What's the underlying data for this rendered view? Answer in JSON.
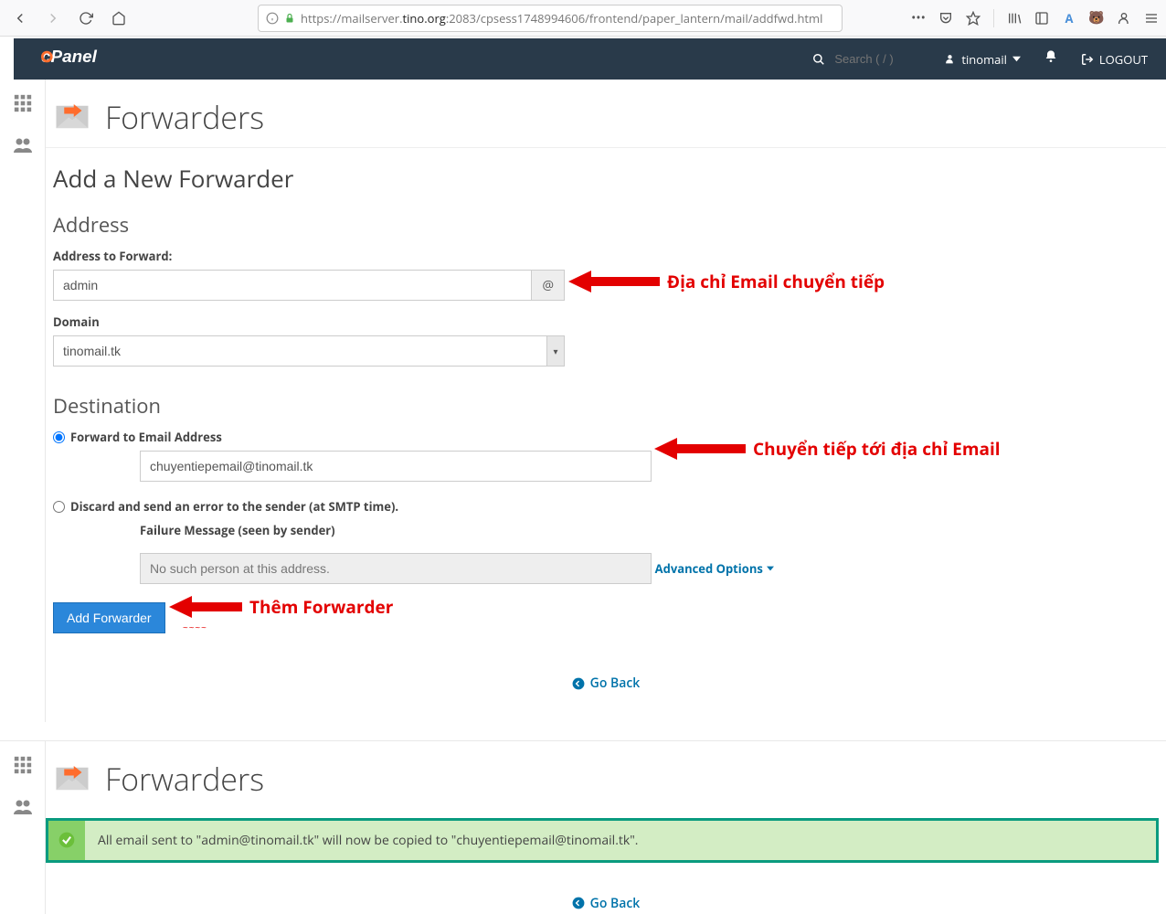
{
  "browser": {
    "url_prefix": "https://mailserver.",
    "url_host": "tino.org",
    "url_suffix": ":2083/cpsess1748994606/frontend/paper_lantern/mail/addfwd.html"
  },
  "header": {
    "search_placeholder": "Search ( / )",
    "user": "tinomail",
    "logout": "LOGOUT"
  },
  "page": {
    "title": "Forwarders",
    "h2": "Add a New Forwarder",
    "address_h3": "Address",
    "addr_label": "Address to Forward:",
    "addr_value": "admin",
    "at": "@",
    "domain_label": "Domain",
    "domain_value": "tinomail.tk",
    "dest_h3": "Destination",
    "radio1": "Forward to Email Address",
    "dest_value": "chuyentiepemail@tinomail.tk",
    "radio2": "Discard and send an error to the sender (at SMTP time).",
    "failure_label": "Failure Message (seen by sender)",
    "failure_value": "No such person at this address.",
    "adv": "Advanced Options",
    "btn": "Add Forwarder",
    "goback": "Go Back"
  },
  "anno": {
    "a1": "Địa chỉ Email chuyển tiếp",
    "a2": "Chuyển tiếp tới địa chỉ Email",
    "a3": "Thêm Forwarder"
  },
  "result": {
    "title": "Forwarders",
    "msg": "All email sent to \"admin@tinomail.tk\" will now be copied to \"chuyentiepemail@tinomail.tk\".",
    "goback": "Go Back"
  }
}
